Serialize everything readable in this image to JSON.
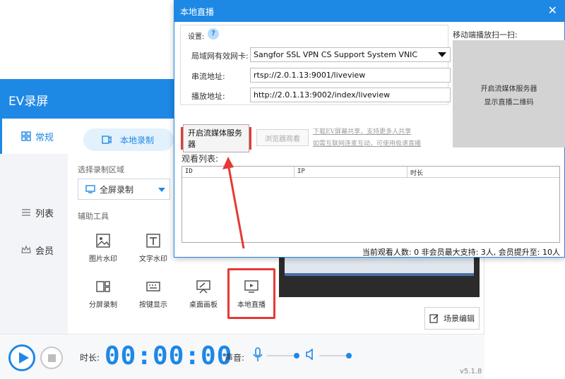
{
  "app": {
    "title": "EV录屏",
    "version": "v5.1.8"
  },
  "sidebar": {
    "items": [
      {
        "label": "常规"
      },
      {
        "label": "列表"
      },
      {
        "label": "会员"
      }
    ]
  },
  "main": {
    "tab_label": "本地录制",
    "region_label": "选择录制区域",
    "region_value": "全屏录制",
    "tools_label": "辅助工具",
    "tools": [
      {
        "label": "图片水印"
      },
      {
        "label": "文字水印"
      },
      {
        "label": "分屏录制"
      },
      {
        "label": "按键显示"
      },
      {
        "label": "桌面画板"
      },
      {
        "label": "本地直播"
      }
    ],
    "scene_edit_label": "场景编辑"
  },
  "bottom": {
    "duration_label": "时长:",
    "timer": "00:00:00",
    "sound_label": "声音:"
  },
  "dialog": {
    "title": "本地直播",
    "close": "✕",
    "settings_label": "设置:",
    "help": "?",
    "nic_label": "局域网有效网卡:",
    "nic_value": "Sangfor SSL VPN CS Support System VNIC",
    "push_label": "串流地址:",
    "push_value": "rtsp://2.0.1.13:9001/liveview",
    "play_label": "播放地址:",
    "play_value": "http://2.0.1.13:9002/index/liveview",
    "qr_label": "移动端播放扫一扫:",
    "qr_line1": "开启流媒体服务器",
    "qr_line2": "显示直播二维码",
    "start_btn": "开启流媒体服务器",
    "browser_btn": "浏览器观看",
    "share_link1": "下载EV屏幕共享，支持更多人共享",
    "share_link2": "如需互联网连麦互动，可使用极速直播",
    "list_label": "观看列表:",
    "columns": [
      "ID",
      "IP",
      "时长"
    ],
    "status": "当前观看人数: 0   非会员最大支持: 3人, 会员提升至: 10人"
  },
  "colors": {
    "accent": "#1e88e5",
    "highlight": "#e53935"
  }
}
